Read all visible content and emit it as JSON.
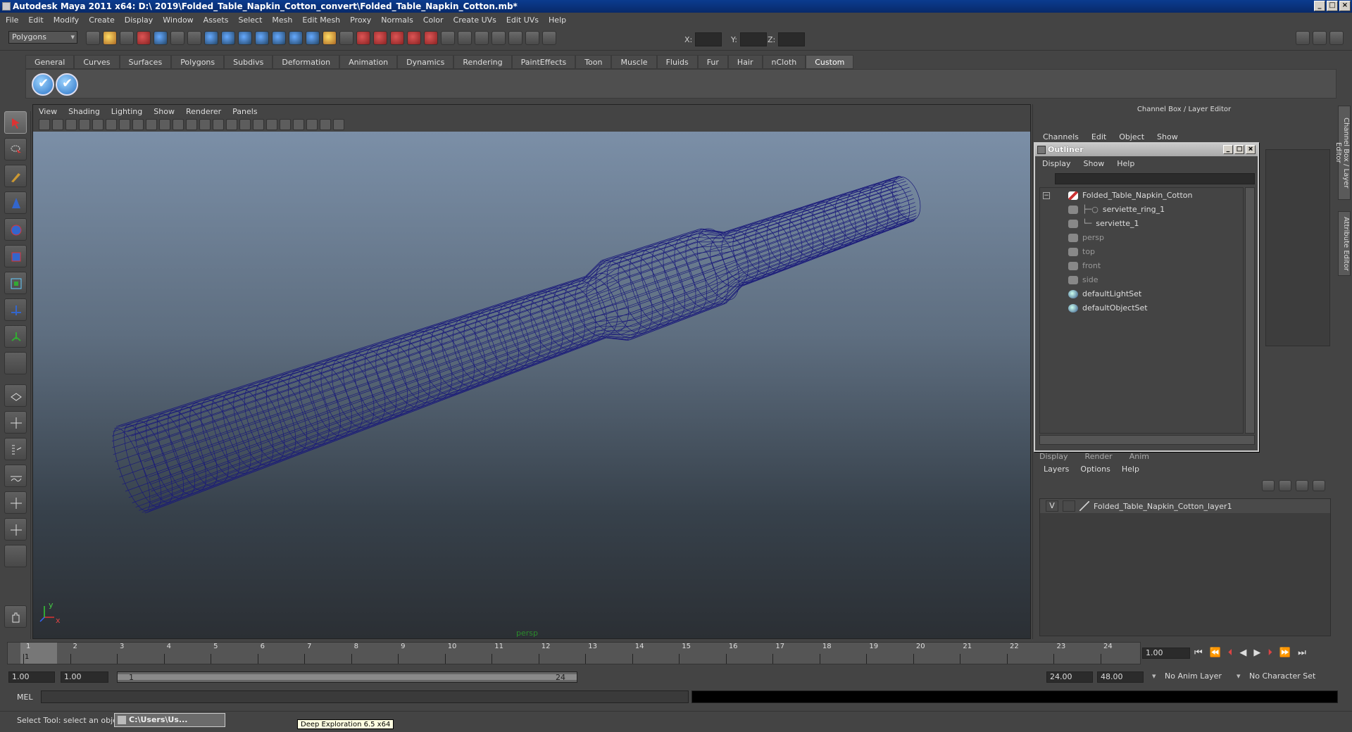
{
  "window": {
    "title": "Autodesk Maya 2011 x64: D:\\ 2019\\Folded_Table_Napkin_Cotton_convert\\Folded_Table_Napkin_Cotton.mb*",
    "minimize": "_",
    "maximize": "□",
    "close": "×"
  },
  "menubar": [
    "File",
    "Edit",
    "Modify",
    "Create",
    "Display",
    "Window",
    "Assets",
    "Select",
    "Mesh",
    "Edit Mesh",
    "Proxy",
    "Normals",
    "Color",
    "Create UVs",
    "Edit UVs",
    "Help"
  ],
  "status_line": {
    "mode": "Polygons",
    "x_label": "X:",
    "y_label": "Y:",
    "z_label": "Z:"
  },
  "shelf": {
    "tabs": [
      "General",
      "Curves",
      "Surfaces",
      "Polygons",
      "Subdivs",
      "Deformation",
      "Animation",
      "Dynamics",
      "Rendering",
      "PaintEffects",
      "Toon",
      "Muscle",
      "Fluids",
      "Fur",
      "Hair",
      "nCloth",
      "Custom"
    ],
    "active_tab": "Custom"
  },
  "viewport": {
    "menu": [
      "View",
      "Shading",
      "Lighting",
      "Show",
      "Renderer",
      "Panels"
    ],
    "camera_label": "persp",
    "axis_x": "x",
    "axis_y": "y",
    "wire_color": "#1a1a7a"
  },
  "channel_box": {
    "title": "Channel Box / Layer Editor",
    "menu": [
      "Channels",
      "Edit",
      "Object",
      "Show"
    ]
  },
  "side_tabs": [
    "Channel Box / Layer Editor",
    "Attribute Editor"
  ],
  "outliner": {
    "title": "Outliner",
    "menu": [
      "Display",
      "Show",
      "Help"
    ],
    "items": [
      {
        "label": "Folded_Table_Napkin_Cotton",
        "dim": false
      },
      {
        "label": "serviette_ring_1",
        "dim": false
      },
      {
        "label": "serviette_1",
        "dim": false
      },
      {
        "label": "persp",
        "dim": true
      },
      {
        "label": "top",
        "dim": true
      },
      {
        "label": "front",
        "dim": true
      },
      {
        "label": "side",
        "dim": true
      },
      {
        "label": "defaultLightSet",
        "dim": false
      },
      {
        "label": "defaultObjectSet",
        "dim": false
      }
    ]
  },
  "layer_editor": {
    "tabs": [
      "Display",
      "Render",
      "Anim"
    ],
    "menu": [
      "Layers",
      "Options",
      "Help"
    ],
    "layer_visibility": "V",
    "layer_name": "Folded_Table_Napkin_Cotton_layer1"
  },
  "time_slider": {
    "ticks": [
      "1",
      "2",
      "3",
      "4",
      "5",
      "6",
      "7",
      "8",
      "9",
      "10",
      "11",
      "12",
      "13",
      "14",
      "15",
      "16",
      "17",
      "18",
      "19",
      "20",
      "21",
      "22",
      "23",
      "24"
    ],
    "current_frame_marker": "1",
    "current_frame": "1.00"
  },
  "range_slider": {
    "start_time": "1.00",
    "playback_start": "1.00",
    "range_start_label": "1",
    "range_end_label": "24",
    "playback_end": "24.00",
    "end_time": "48.00",
    "anim_layer": "No Anim Layer",
    "character_set": "No Character Set"
  },
  "command_line": {
    "label": "MEL"
  },
  "help_line": {
    "text": "Select Tool: select an object",
    "task_button": "C:\\Users\\Us...",
    "tooltip": "Deep Exploration 6.5 x64"
  }
}
